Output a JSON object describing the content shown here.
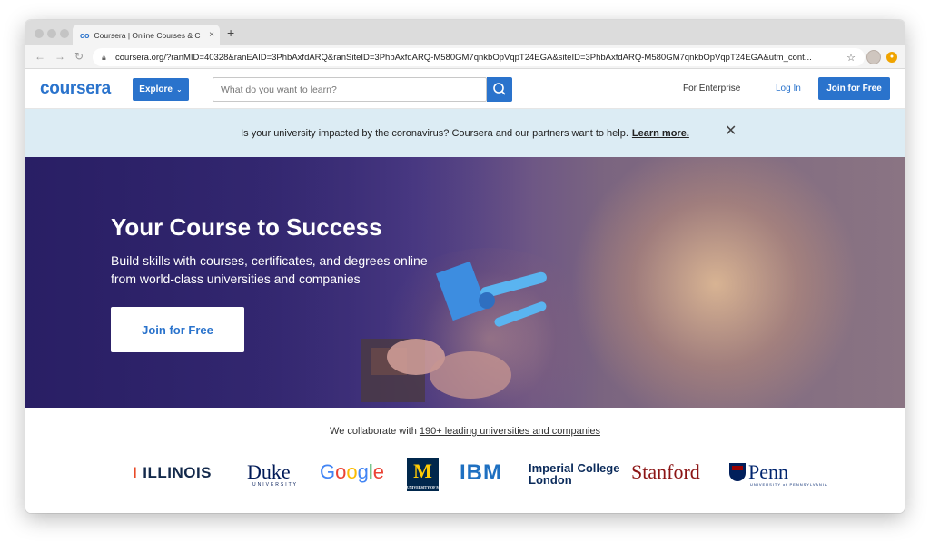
{
  "browser": {
    "tab_title": "Coursera | Online Courses & C",
    "tab_favicon": "co",
    "url": "coursera.org/?ranMID=40328&ranEAID=3PhbAxfdARQ&ranSiteID=3PhbAxfdARQ-M580GM7qnkbOpVqpT24EGA&siteID=3PhbAxfdARQ-M580GM7qnkbOpVqpT24EGA&utm_cont..."
  },
  "header": {
    "logo": "coursera",
    "explore_label": "Explore",
    "search_placeholder": "What do you want to learn?",
    "enterprise_label": "For Enterprise",
    "login_label": "Log In",
    "join_label": "Join for Free"
  },
  "banner": {
    "message": "Is your university impacted by the coronavirus? Coursera and our partners want to help.",
    "link": "Learn more."
  },
  "hero": {
    "title": "Your Course to Success",
    "subtitle": "Build skills with courses, certificates, and degrees online from world-class universities and companies",
    "cta": "Join for Free"
  },
  "partners": {
    "intro": "We collaborate with",
    "link": "190+ leading universities and companies",
    "logos": {
      "illinois": "ILLINOIS",
      "duke": "Duke",
      "duke_sub": "UNIVERSITY",
      "google": "Google",
      "michigan": "M",
      "michigan_sub": "UNIVERSITY OF MICHIGAN",
      "ibm": "IBM",
      "imperial_1": "Imperial College",
      "imperial_2": "London",
      "stanford": "Stanford",
      "penn": "Penn",
      "penn_sub": "UNIVERSITY of PENNSYLVANIA"
    }
  },
  "colors": {
    "brand": "#2a73cc",
    "banner_bg": "#dcecf4",
    "hero_bg": "#2e2268"
  }
}
